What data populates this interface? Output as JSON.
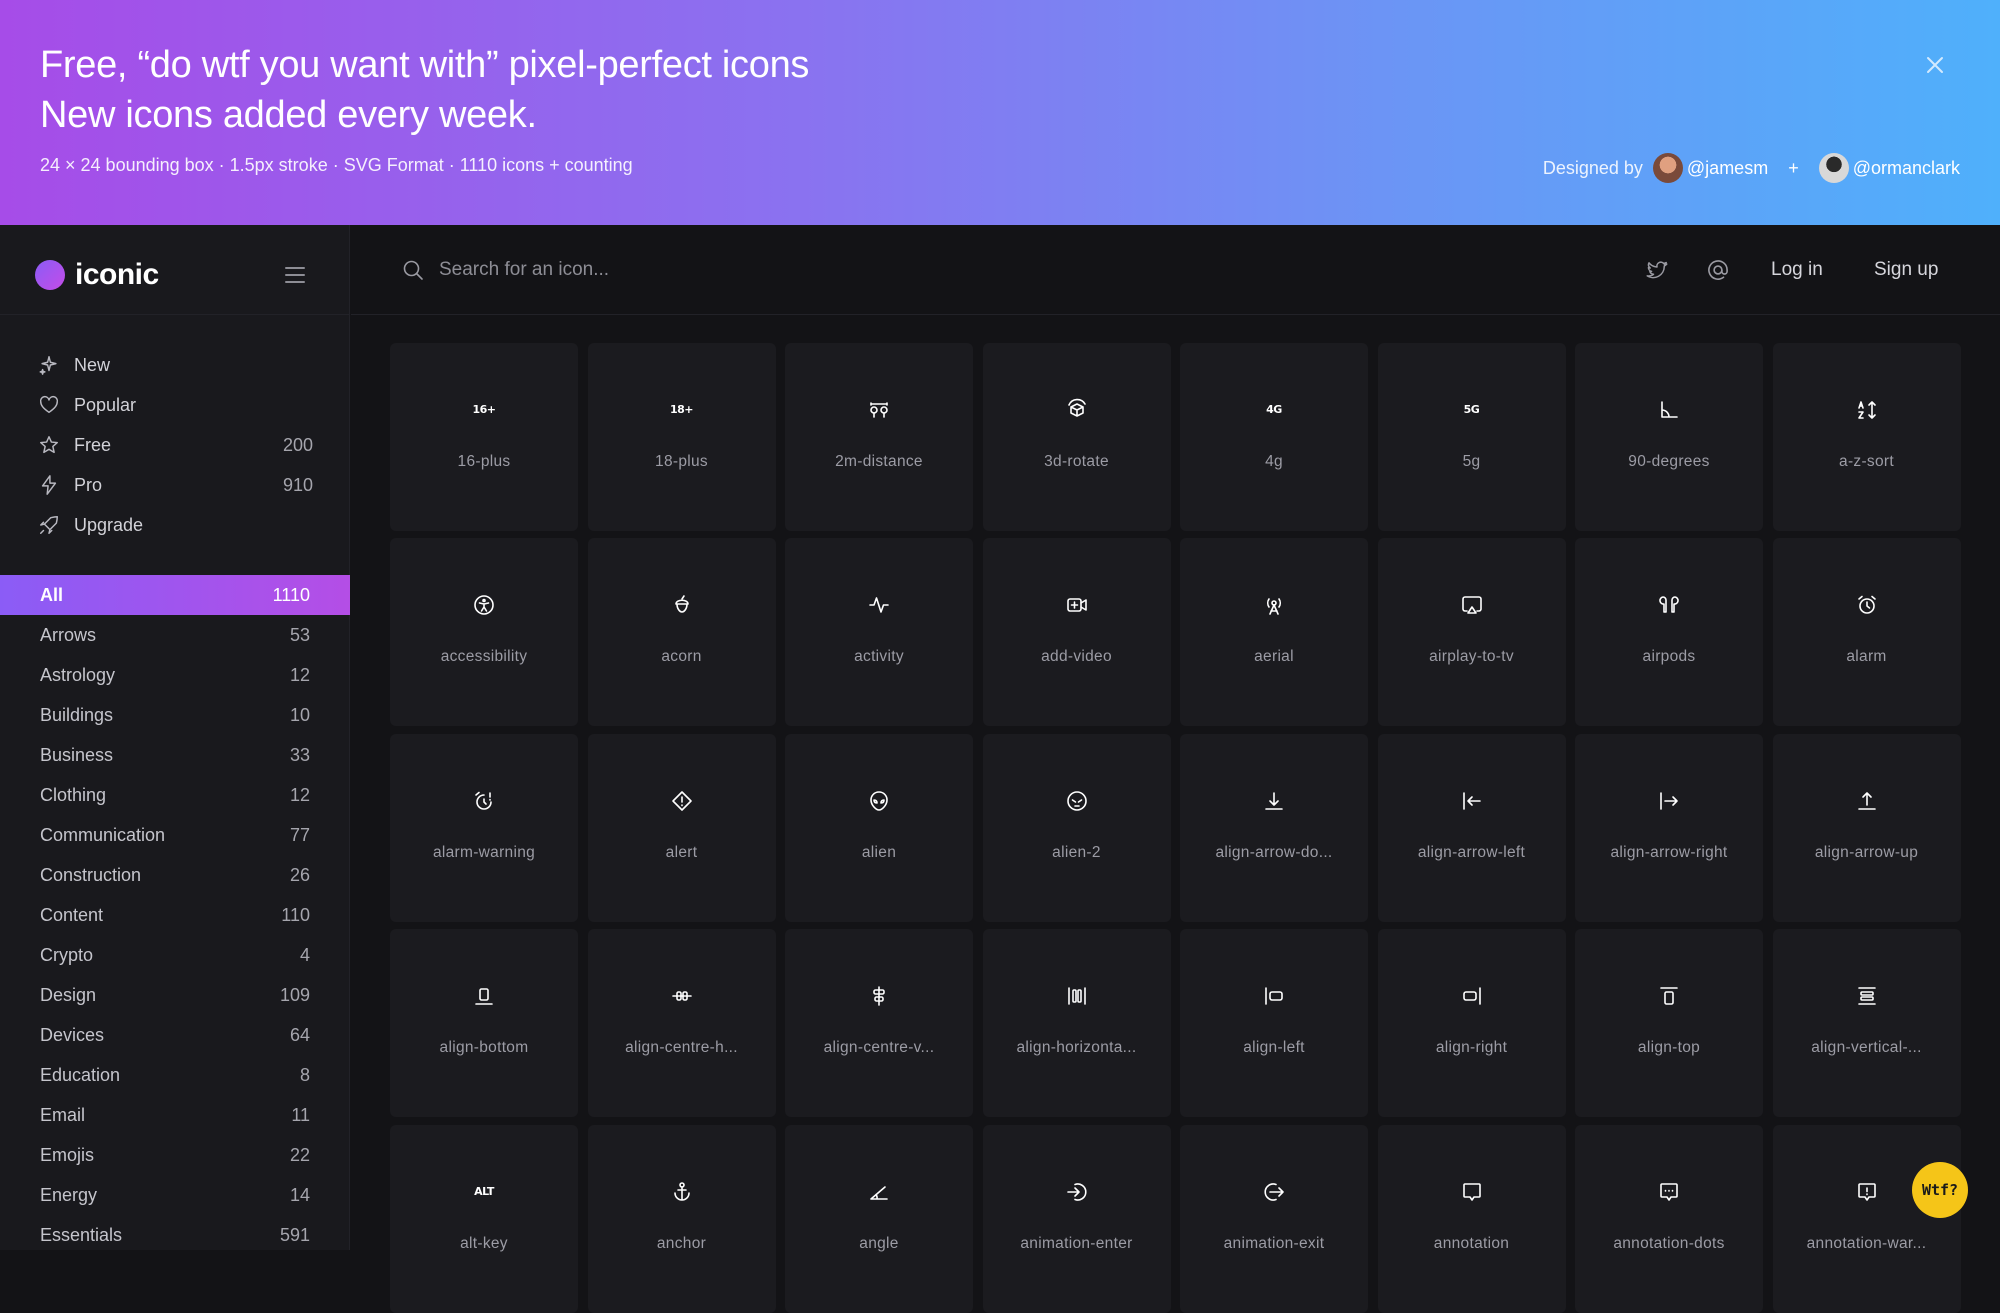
{
  "banner": {
    "line1": "Free, “do wtf you want with” pixel-perfect icons",
    "line2": "New icons added every week.",
    "sub": "24 × 24 bounding box · 1.5px stroke · SVG Format · 1110 icons + counting",
    "designed_by": "Designed by",
    "designer1": "@jamesm",
    "plus": "+",
    "designer2": "@ormanclark"
  },
  "brand": {
    "name": "iconic"
  },
  "quick": [
    {
      "label": "New",
      "count": "",
      "icon": "sparkle-icon"
    },
    {
      "label": "Popular",
      "count": "",
      "icon": "heart-icon"
    },
    {
      "label": "Free",
      "count": "200",
      "icon": "star-icon"
    },
    {
      "label": "Pro",
      "count": "910",
      "icon": "lightning-icon"
    },
    {
      "label": "Upgrade",
      "count": "",
      "icon": "rocket-icon"
    }
  ],
  "categories": [
    {
      "label": "All",
      "count": "1110"
    },
    {
      "label": "Arrows",
      "count": "53"
    },
    {
      "label": "Astrology",
      "count": "12"
    },
    {
      "label": "Buildings",
      "count": "10"
    },
    {
      "label": "Business",
      "count": "33"
    },
    {
      "label": "Clothing",
      "count": "12"
    },
    {
      "label": "Communication",
      "count": "77"
    },
    {
      "label": "Construction",
      "count": "26"
    },
    {
      "label": "Content",
      "count": "110"
    },
    {
      "label": "Crypto",
      "count": "4"
    },
    {
      "label": "Design",
      "count": "109"
    },
    {
      "label": "Devices",
      "count": "64"
    },
    {
      "label": "Education",
      "count": "8"
    },
    {
      "label": "Email",
      "count": "11"
    },
    {
      "label": "Emojis",
      "count": "22"
    },
    {
      "label": "Energy",
      "count": "14"
    },
    {
      "label": "Essentials",
      "count": "591"
    }
  ],
  "topbar": {
    "search_placeholder": "Search for an icon...",
    "login": "Log in",
    "signup": "Sign up"
  },
  "icons": [
    "16-plus",
    "18-plus",
    "2m-distance",
    "3d-rotate",
    "4g",
    "5g",
    "90-degrees",
    "a-z-sort",
    "accessibility",
    "acorn",
    "activity",
    "add-video",
    "aerial",
    "airplay-to-tv",
    "airpods",
    "alarm",
    "alarm-warning",
    "alert",
    "alien",
    "alien-2",
    "align-arrow-do...",
    "align-arrow-left",
    "align-arrow-right",
    "align-arrow-up",
    "align-bottom",
    "align-centre-h...",
    "align-centre-v...",
    "align-horizonta...",
    "align-left",
    "align-right",
    "align-top",
    "align-vertical-...",
    "alt-key",
    "anchor",
    "angle",
    "animation-enter",
    "animation-exit",
    "annotation",
    "annotation-dots",
    "annotation-war..."
  ],
  "text_glyphs": {
    "16-plus": "16+",
    "18-plus": "18+",
    "4g": "4G",
    "5g": "5G",
    "alt-key": "ALT"
  },
  "wtf_button": "Wtf?",
  "colors": {
    "accent": "#8b5cf6",
    "active_gradient_end": "#b44ee6",
    "wtf_yellow": "#f5c518"
  }
}
